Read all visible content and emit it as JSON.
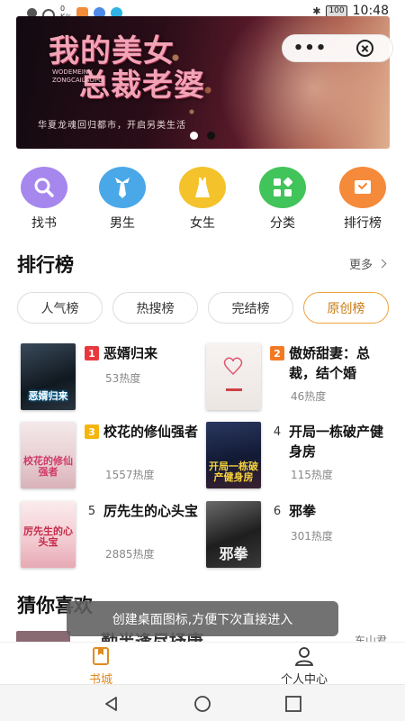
{
  "status_bar": {
    "left_small": "0\nK/s",
    "battery": "100",
    "time": "10:48"
  },
  "banner": {
    "title_line1": "我的美女",
    "title_line2": "总裁老婆",
    "title_en": "WODEMEINV ZONGCAILAOPO",
    "subtitle": "华夏龙魂回归都市，开启另类生活",
    "capsule_more": "•••"
  },
  "categories": [
    {
      "label": "找书",
      "icon": "search-icon",
      "color": "#9b7de8"
    },
    {
      "label": "男生",
      "icon": "tie-icon",
      "color": "#4aa8e8"
    },
    {
      "label": "女生",
      "icon": "dress-icon",
      "color": "#f4c22b"
    },
    {
      "label": "分类",
      "icon": "category-icon",
      "color": "#41c45a"
    },
    {
      "label": "排行榜",
      "icon": "ranking-icon",
      "color": "#f58a3a"
    }
  ],
  "ranking": {
    "title": "排行榜",
    "more": "更多",
    "tabs": [
      "人气榜",
      "热搜榜",
      "完结榜",
      "原创榜"
    ],
    "active_tab": 3,
    "books": [
      {
        "rank": "1",
        "name": "恶婿归来",
        "heat": "53热度",
        "cover_text": "恶婿归来",
        "rank_color": "#e8373d"
      },
      {
        "rank": "2",
        "name": "傲娇甜妻：总裁，结个婚",
        "heat": "46热度",
        "cover_text": "",
        "rank_color": "#f27a25"
      },
      {
        "rank": "3",
        "name": "校花的修仙强者",
        "heat": "1557热度",
        "cover_text": "校花的修仙强者",
        "rank_color": "#f5b50d"
      },
      {
        "rank": "4",
        "name": "开局一栋破产健身房",
        "heat": "115热度",
        "cover_text": "开局一栋破产健身房",
        "rank_color": ""
      },
      {
        "rank": "5",
        "name": "厉先生的心头宝",
        "heat": "2885热度",
        "cover_text": "厉先生的心头宝",
        "rank_color": ""
      },
      {
        "rank": "6",
        "name": "邪拳",
        "heat": "301热度",
        "cover_text": "邪拳",
        "rank_color": ""
      }
    ]
  },
  "guess": {
    "title": "猜你喜欢",
    "peek_text": "勤半逢尽抒唐",
    "peek_author": "东山君"
  },
  "toast": "创建桌面图标,方便下次直接进入",
  "bottom_nav": {
    "items": [
      {
        "label": "书城",
        "icon": "bookstore-icon",
        "active": true
      },
      {
        "label": "个人中心",
        "icon": "user-icon",
        "active": false
      }
    ],
    "active_color": "#e08a1e"
  }
}
